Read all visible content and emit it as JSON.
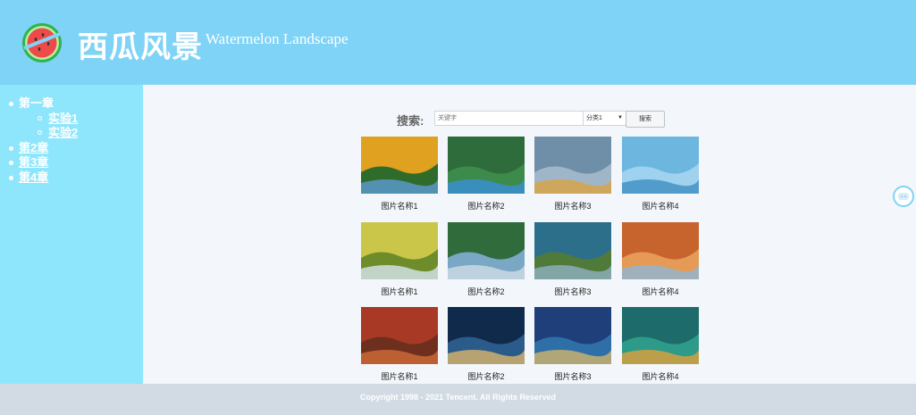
{
  "header": {
    "title": "西瓜风景",
    "subtitle": "Watermelon Landscape",
    "logo_icon": "watermelon-icon"
  },
  "sidebar": {
    "chapters": [
      {
        "label": "第一章",
        "children": [
          {
            "label": "实验1"
          },
          {
            "label": "实验2"
          }
        ]
      },
      {
        "label": "第2章"
      },
      {
        "label": "第3章"
      },
      {
        "label": "第4章"
      }
    ]
  },
  "search": {
    "label": "搜索:",
    "placeholder": "关键字",
    "category": "分类1",
    "button": "搜索"
  },
  "gallery": [
    {
      "caption": "图片名称1",
      "theme": "autumn-forest-lake"
    },
    {
      "caption": "图片名称2",
      "theme": "forest-pool"
    },
    {
      "caption": "图片名称3",
      "theme": "misty-river"
    },
    {
      "caption": "图片名称4",
      "theme": "blue-water"
    },
    {
      "caption": "图片名称1",
      "theme": "road-fields"
    },
    {
      "caption": "图片名称2",
      "theme": "river-valley"
    },
    {
      "caption": "图片名称3",
      "theme": "sea-cliff"
    },
    {
      "caption": "图片名称4",
      "theme": "canyon"
    },
    {
      "caption": "图片名称1",
      "theme": "red-trees"
    },
    {
      "caption": "图片名称2",
      "theme": "city-night"
    },
    {
      "caption": "图片名称3",
      "theme": "island-blue"
    },
    {
      "caption": "图片名称4",
      "theme": "turtle-sea"
    }
  ],
  "footer": {
    "text": "Copyright 1998 - 2021 Tencent. All Rights Reserved"
  },
  "colors": {
    "header": "#7fd3f6",
    "sidebar": "#8de6fb",
    "footer": "#d2dbe3",
    "content": "#f3f7fb"
  }
}
